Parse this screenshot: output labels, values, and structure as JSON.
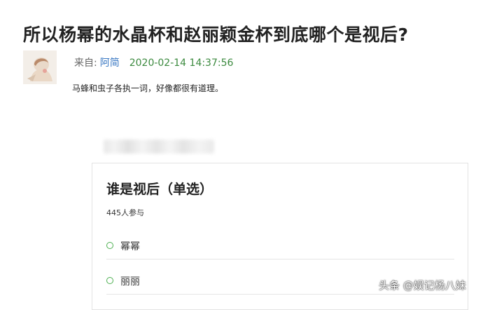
{
  "article": {
    "title": "所以杨幂的水晶杯和赵丽颖金杯到底哪个是视后?",
    "from_label": "来自:",
    "author": "阿简",
    "timestamp": "2020-02-14 14:37:56",
    "excerpt": "马蜂和虫子各执一词，好像都很有道理。"
  },
  "poll": {
    "title": "谁是视后（单选）",
    "participants": "445人参与",
    "options": [
      {
        "label": "幂幂"
      },
      {
        "label": "丽丽"
      }
    ]
  },
  "watermark": "头条 @娱记杨八妹",
  "colors": {
    "author_link": "#3a78c3",
    "timestamp": "#3c8a3f",
    "radio": "#4caf50"
  }
}
